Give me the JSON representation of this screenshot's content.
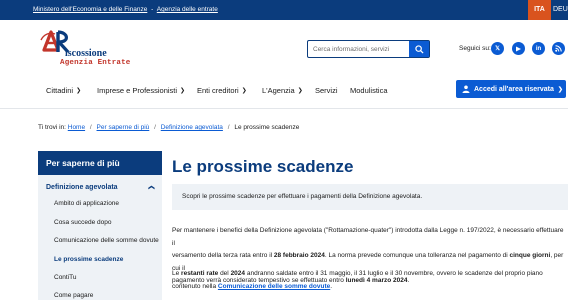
{
  "topbar": {
    "link1": "Ministero dell'Economia e delle Finanze",
    "separator": "-",
    "link2": "Agenzia delle entrate",
    "lang_active": "ITA",
    "lang_other": "DEU"
  },
  "header": {
    "logo_line1": "iscossione",
    "logo_line2": "Agenzia Entrate",
    "search_placeholder": "Cerca informazioni, servizi",
    "social_label": "Seguici su:",
    "social_icons": [
      "x-icon",
      "youtube-icon",
      "linkedin-icon",
      "rss-icon"
    ]
  },
  "nav": {
    "items": [
      {
        "label": "Cittadini",
        "has_menu": true
      },
      {
        "label": "Imprese e Professionisti",
        "has_menu": true
      },
      {
        "label": "Enti creditori",
        "has_menu": true
      },
      {
        "label": "L'Agenzia",
        "has_menu": true
      },
      {
        "label": "Servizi",
        "has_menu": false
      },
      {
        "label": "Modulistica",
        "has_menu": false
      }
    ],
    "access_button": "Accedi all'area riservata"
  },
  "breadcrumb": {
    "prefix": "Ti trovi in:",
    "items": [
      "Home",
      "Per saperne di più",
      "Definizione agevolata"
    ],
    "current": "Le prossime scadenze",
    "separator": "/"
  },
  "sidebar": {
    "title": "Per saperne di più",
    "section": "Definizione agevolata",
    "items": [
      "Ambito di applicazione",
      "Cosa succede dopo",
      "Comunicazione delle somme dovute",
      "Le prossime scadenze",
      "ContiTu",
      "Come pagare"
    ],
    "active_index": 3
  },
  "main": {
    "title": "Le prossime scadenze",
    "intro": "Scopri le prossime scadenze per effettuare i pagamenti della Definizione agevolata.",
    "p1": {
      "a": "Per mantenere i benefici della Definizione agevolata (\"Rottamazione-quater\") introdotta dalla Legge n. 197/2022, è necessario effettuare il",
      "b": "versamento della terza rata entro il ",
      "b_bold": "28 febbraio 2024",
      "c": ". La norma prevede comunque una tolleranza nel pagamento di ",
      "c_bold": "cinque giorni",
      "d": ", per cui il",
      "e": "pagamento verrà considerato tempestivo se effettuato entro ",
      "e_bold": "lunedì 4 marzo 2024",
      "f": "."
    },
    "p2": {
      "a": "Le ",
      "a_bold": "restanti rate",
      "b": " del ",
      "b_bold": "2024",
      "c": " andranno saldate entro il 31 maggio, il 31 luglio e il 30 novembre, ovvero le scadenze del proprio piano",
      "d": "contenuto nella ",
      "link": "Comunicazione delle somme dovute",
      "e": "."
    }
  },
  "colors": {
    "primary_dark": "#0b3c7d",
    "primary": "#0b5bd3",
    "accent": "#d9531e",
    "sidebar_bg": "#eef2f6"
  }
}
